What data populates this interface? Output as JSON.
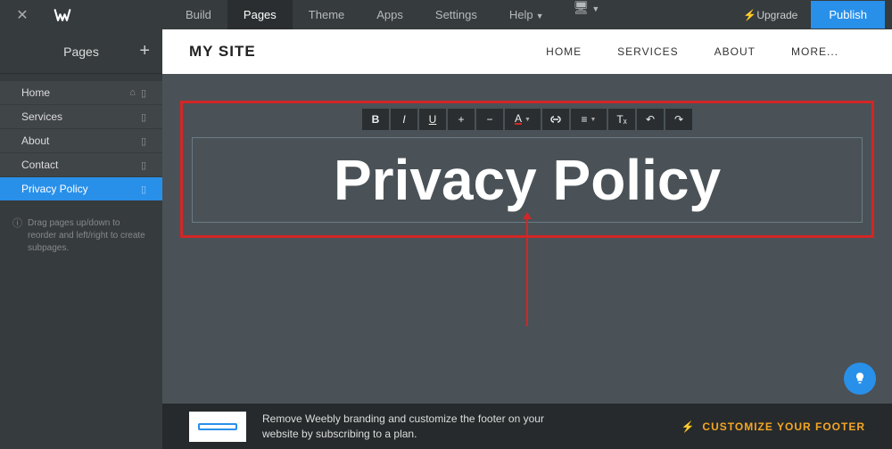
{
  "topbar": {
    "tabs": [
      "Build",
      "Pages",
      "Theme",
      "Apps",
      "Settings",
      "Help"
    ],
    "active_tab": "Pages",
    "upgrade": "Upgrade",
    "publish": "Publish"
  },
  "sidebar": {
    "title": "Pages",
    "items": [
      {
        "label": "Home"
      },
      {
        "label": "Services"
      },
      {
        "label": "About"
      },
      {
        "label": "Contact"
      },
      {
        "label": "Privacy Policy"
      }
    ],
    "active_index": 4,
    "hint": "Drag pages up/down to reorder and left/right to create subpages."
  },
  "site": {
    "title": "MY SITE",
    "nav": [
      "HOME",
      "SERVICES",
      "ABOUT",
      "MORE..."
    ]
  },
  "editor": {
    "heading": "Privacy Policy",
    "toolbar": {
      "bold": "B",
      "italic": "I",
      "underline": "U",
      "increase": "+",
      "decrease": "−",
      "textcolor": "A",
      "link": "⮂",
      "align": "≡",
      "clear": "Tₓ",
      "undo": "↶",
      "redo": "↷"
    }
  },
  "footer": {
    "text_line1": "Remove Weebly branding and customize the footer on your",
    "text_line2": "website by subscribing to a plan.",
    "cta": "CUSTOMIZE YOUR FOOTER"
  }
}
